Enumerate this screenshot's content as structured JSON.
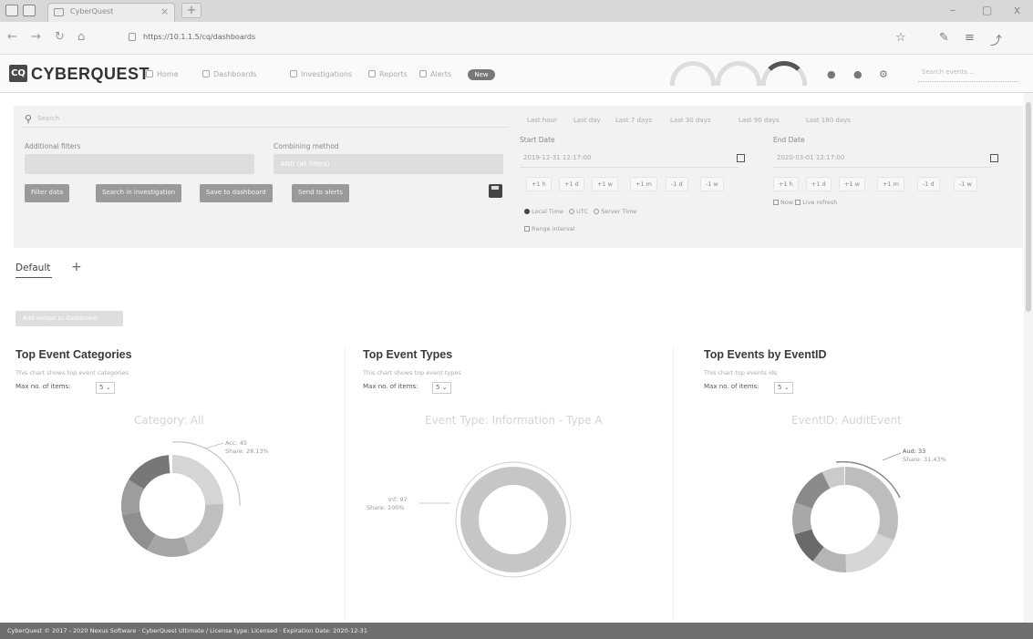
{
  "browser": {
    "tab_title": "CyberQuest",
    "tab_close": "×",
    "new_tab": "+",
    "url": "https://10.1.1.5/cq/dashboards",
    "win_min": "–",
    "win_max": "▢",
    "win_close": "x",
    "back_glyph": "←",
    "forward_glyph": "→",
    "reload_glyph": "↻",
    "home_glyph": "⌂",
    "star_glyph": "☆",
    "favorites_glyph": "✎",
    "hub_glyph": "≡",
    "share_glyph": "⤴"
  },
  "app": {
    "logo_mark": "CQ",
    "logo_text": "CYBERQUEST",
    "menu": [
      {
        "label": "Home"
      },
      {
        "label": "Dashboards"
      },
      {
        "label": "Investigations"
      },
      {
        "label": "Reports"
      },
      {
        "label": "Alerts"
      }
    ],
    "new_badge": "New",
    "user_label": "Search events…",
    "icons": {
      "bell": "●",
      "user": "●",
      "settings": "⚙"
    }
  },
  "filters": {
    "search_placeholder": "Search",
    "additional_filters_label": "Additional filters",
    "combining_method_label": "Combining method",
    "combining_method_value": "AND (all filters)",
    "buttons": {
      "filter": "Filter data",
      "search_investigation": "Search in investigation",
      "save_layout": "Save to dashboard",
      "export": "Send to alerts"
    },
    "quick_ranges": [
      "Last hour",
      "Last day",
      "Last 7 days",
      "Last 30 days",
      "Last 90 days",
      "Last 180 days"
    ],
    "start_date_label": "Start Date",
    "start_date_value": "2019-12-31 12:17:00",
    "end_date_label": "End Date",
    "end_date_value": "2020-03-01 12:17:00",
    "start_chips": [
      "+1 h",
      "+1 d",
      "+1 w",
      "+1 m",
      "-1 d",
      "-1 w"
    ],
    "end_chips": [
      "+1 h",
      "+1 d",
      "+1 w",
      "+1 m",
      "-1 d",
      "-1 w"
    ],
    "timezones": [
      "Local Time",
      "UTC",
      "Server Time"
    ],
    "range_interval": "Range interval",
    "end_options": [
      "Now",
      "Live refresh"
    ]
  },
  "dashboard": {
    "tab": "Default",
    "add_tab": "+",
    "add_widget": "Add widget to dashboard"
  },
  "widgets": [
    {
      "title": "Top Event Categories",
      "desc": "This chart shows top event categories",
      "max_label": "Max no. of items:",
      "max_value": "5",
      "chart_title": "Category: All",
      "legend_line1": "Acc: 45",
      "legend_line2": "Share: 28.13%"
    },
    {
      "title": "Top Event Types",
      "desc": "This chart shows top event types",
      "max_label": "Max no. of items:",
      "max_value": "5",
      "chart_title": "Event Type: Information - Type A",
      "legend_line1": "Inf: 97",
      "legend_line2": "Share: 100%"
    },
    {
      "title": "Top Events by EventID",
      "desc": "This chart top events ids",
      "max_label": "Max no. of items:",
      "max_value": "5",
      "chart_title": "EventID: AuditEvent",
      "legend_line1": "Aud: 33",
      "legend_line2": "Share: 31.43%"
    }
  ],
  "footer": {
    "text": "CyberQuest © 2017 - 2020 Nexus Software · CyberQuest Ultimate / License type: Licensed · Expiration Date: 2020-12-31"
  }
}
